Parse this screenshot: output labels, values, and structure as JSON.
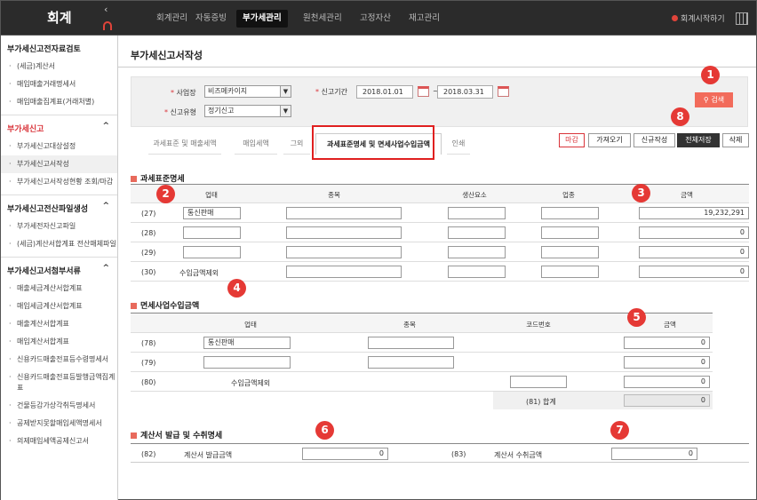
{
  "app": {
    "title": "회계"
  },
  "topmenu": [
    "회계관리",
    "자동증빙",
    "부가세관리",
    "원천세관리",
    "고정자산",
    "재고관리"
  ],
  "topbar": {
    "start_label": "회계시작하기"
  },
  "sidebar": [
    {
      "title": "부가세신고전자료검토",
      "items": [
        "(세금)계산서",
        "매입매출거래명세서",
        "매입매출집계표(거래처별)"
      ]
    },
    {
      "title": "부가세신고",
      "items": [
        "부가세신고대상설정",
        "부가세신고서작성",
        "부가세신고서작성현황 조회/마감"
      ]
    },
    {
      "title": "부가세신고전산파일생성",
      "items": [
        "부가세전자신고파일",
        "(세금)계산서합계표 전산매체파일"
      ]
    },
    {
      "title": "부가세신고서첨부서류",
      "items": [
        "매출세금계산서합계표",
        "매입세금계산서합계표",
        "매출계산서합계표",
        "매입계산서합계표",
        "신용카드매출전표등수령명세서",
        "신용카드매출전표등발행금액집계표",
        "건물등감가상각취득명세서",
        "공제받지못할매입세액명세서",
        "의제매입세액공제신고서"
      ]
    }
  ],
  "page": {
    "title": "부가세신고서작성"
  },
  "search": {
    "biz_label": "사업장",
    "biz_value": "비즈메카이지",
    "period_label": "신고기간",
    "date_from": "2018.01.01",
    "date_sep": "~",
    "date_to": "2018.03.31",
    "type_label": "신고유형",
    "type_value": "정기신고",
    "search_btn": "검색"
  },
  "tabs": [
    "과세표준 및 매출세액",
    "매입세액",
    "그외",
    "과세표준명세 및 면세사업수입금액",
    "인쇄"
  ],
  "actions": [
    "마감",
    "가져오기",
    "신규작성",
    "전체저장",
    "삭제"
  ],
  "tax": {
    "title": "과세표준명세",
    "headers": [
      "업태",
      "종목",
      "생산요소",
      "업종",
      "금액"
    ],
    "rows": [
      {
        "no": "(27)",
        "c1": "통신판매",
        "amount": "19,232,291"
      },
      {
        "no": "(28)",
        "c1": "",
        "amount": "0"
      },
      {
        "no": "(29)",
        "c1": "",
        "amount": "0"
      },
      {
        "no": "(30)",
        "c1": "수입금액제외",
        "amount": "0"
      }
    ]
  },
  "exempt": {
    "title": "면세사업수입금액",
    "headers": [
      "업태",
      "종목",
      "코드번호",
      "금액"
    ],
    "rows": [
      {
        "no": "(78)",
        "c1": "통신판매",
        "amount": "0"
      },
      {
        "no": "(79)",
        "c1": "",
        "amount": "0"
      },
      {
        "no": "(80)",
        "c1": "수입금액제외",
        "amount": "0"
      }
    ],
    "sum_label": "(81) 합계",
    "sum_value": "0"
  },
  "invoice": {
    "title": "계산서 발급 및 수취명세",
    "no1": "(82)",
    "label1": "계산서 발급금액",
    "value1": "0",
    "no2": "(83)",
    "label2": "계산서 수취금액",
    "value2": "0"
  },
  "badges": [
    "1",
    "2",
    "3",
    "4",
    "5",
    "6",
    "7",
    "8"
  ]
}
